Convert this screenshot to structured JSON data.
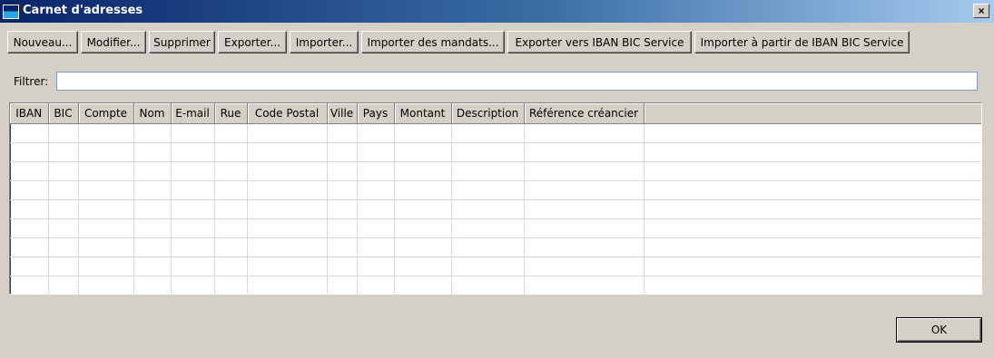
{
  "window": {
    "title": "Carnet d'adresses",
    "close_label": "×"
  },
  "toolbar": {
    "buttons": [
      "Nouveau...",
      "Modifier...",
      "Supprimer",
      "Exporter...",
      "Importer...",
      "Importer des mandats...",
      "Exporter vers IBAN BIC Service",
      "Importer à partir de IBAN BIC Service"
    ]
  },
  "filter": {
    "label": "Filtrer:",
    "value": ""
  },
  "table": {
    "columns": [
      "IBAN",
      "BIC",
      "Compte",
      "Nom",
      "E-mail",
      "Rue",
      "Code Postal",
      "Ville",
      "Pays",
      "Montant",
      "Description",
      "Référence créancier"
    ],
    "rows": []
  },
  "footer": {
    "ok_label": "OK"
  }
}
